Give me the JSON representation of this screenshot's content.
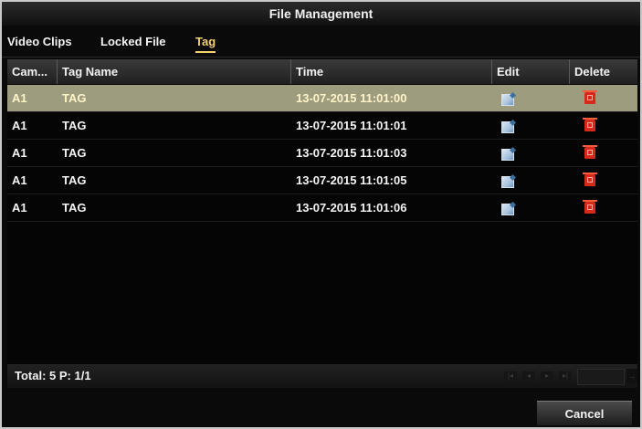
{
  "window": {
    "title": "File Management"
  },
  "tabs": [
    {
      "label": "Video Clips"
    },
    {
      "label": "Locked File"
    },
    {
      "label": "Tag",
      "active": true
    }
  ],
  "table": {
    "columns": [
      "Cam...",
      "Tag Name",
      "Time",
      "Edit",
      "Delete"
    ],
    "rows": [
      {
        "cam": "A1",
        "tag": "TAG",
        "time": "13-07-2015 11:01:00",
        "selected": true
      },
      {
        "cam": "A1",
        "tag": "TAG",
        "time": "13-07-2015 11:01:01"
      },
      {
        "cam": "A1",
        "tag": "TAG",
        "time": "13-07-2015 11:01:03"
      },
      {
        "cam": "A1",
        "tag": "TAG",
        "time": "13-07-2015 11:01:05"
      },
      {
        "cam": "A1",
        "tag": "TAG",
        "time": "13-07-2015 11:01:06"
      }
    ]
  },
  "footer": {
    "total": "Total: 5 P: 1/1",
    "pager_icons": [
      "first-page-icon",
      "prev-page-icon",
      "next-page-icon",
      "last-page-icon"
    ]
  },
  "buttons": {
    "cancel": "Cancel"
  },
  "colors": {
    "selected_row": "#9d9c7f",
    "active_tab": "#f4d36b",
    "delete_icon": "#d52a1a"
  }
}
